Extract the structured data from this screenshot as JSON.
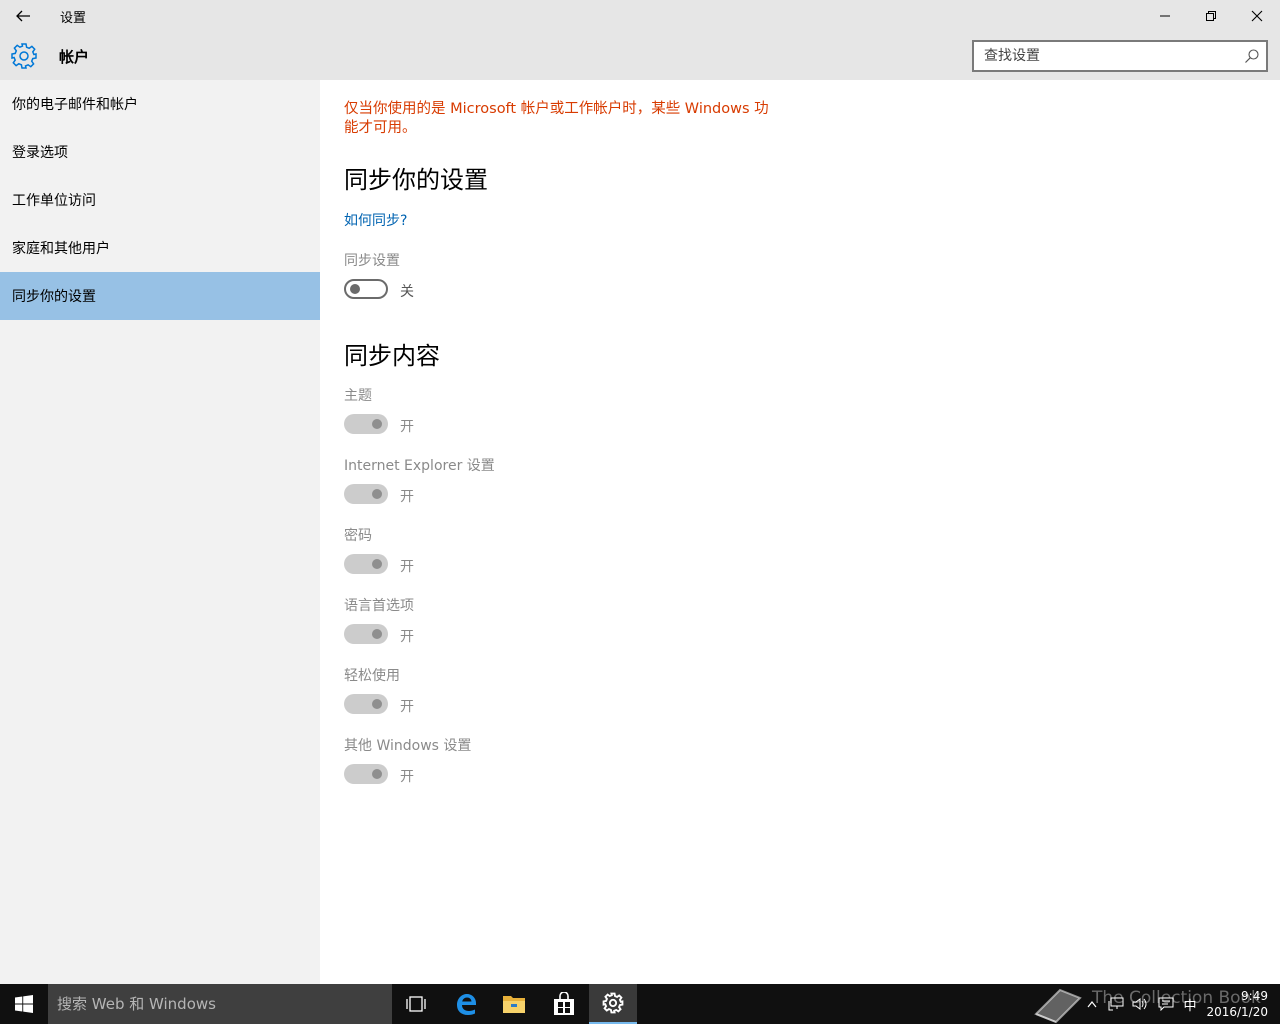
{
  "window": {
    "title": "设置",
    "back_icon": "arrow-left-icon",
    "minimize_icon": "minimize-icon",
    "restore_icon": "restore-icon",
    "close_icon": "close-icon"
  },
  "header": {
    "icon": "gear-icon",
    "title": "帐户",
    "search_placeholder": "查找设置"
  },
  "sidebar": {
    "items": [
      {
        "label": "你的电子邮件和帐户",
        "active": false
      },
      {
        "label": "登录选项",
        "active": false
      },
      {
        "label": "工作单位访问",
        "active": false
      },
      {
        "label": "家庭和其他用户",
        "active": false
      },
      {
        "label": "同步你的设置",
        "active": true
      }
    ]
  },
  "content": {
    "warning_line1": "仅当你使用的是 Microsoft 帐户或工作帐户时，某些 Windows 功",
    "warning_line2": "能才可用。",
    "sync_heading": "同步你的设置",
    "how_link": "如何同步?",
    "sync_settings_label": "同步设置",
    "sync_settings_state": "关",
    "sync_content_heading": "同步内容",
    "items": [
      {
        "label": "主题",
        "state": "开"
      },
      {
        "label": "Internet Explorer 设置",
        "state": "开"
      },
      {
        "label": "密码",
        "state": "开"
      },
      {
        "label": "语言首选项",
        "state": "开"
      },
      {
        "label": "轻松使用",
        "state": "开"
      },
      {
        "label": "其他 Windows 设置",
        "state": "开"
      }
    ]
  },
  "colors": {
    "warning": "#d83b01",
    "link": "#0063b1",
    "active_nav": "#97c1e5",
    "accent": "#0078d7"
  },
  "taskbar": {
    "search_placeholder": "搜索 Web 和 Windows",
    "apps": [
      "task-view-icon",
      "edge-icon",
      "file-explorer-icon",
      "store-icon",
      "settings-icon"
    ],
    "watermark": "The Collection Book",
    "ime": "中",
    "time": "9:49",
    "date": "2016/1/20"
  }
}
